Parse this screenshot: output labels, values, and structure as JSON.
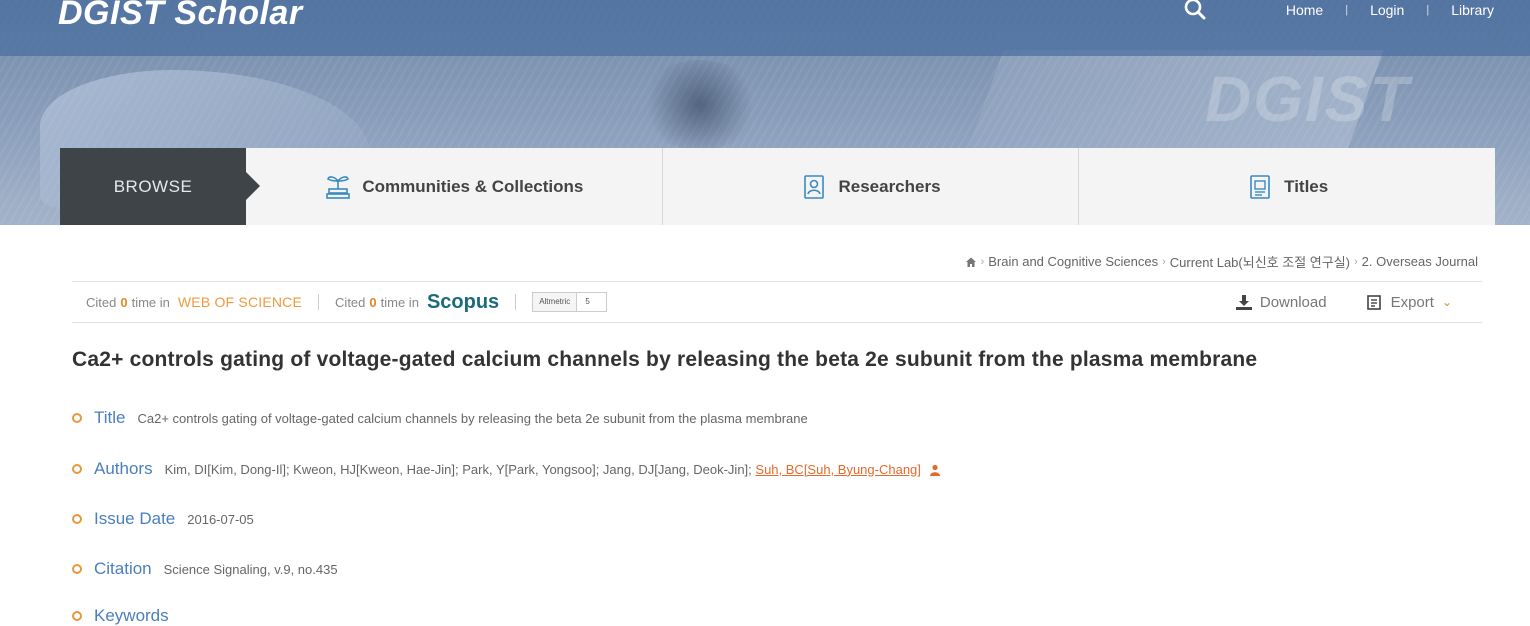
{
  "header": {
    "logo": "DGIST Scholar",
    "watermark": "DGIST",
    "nav": [
      {
        "label": "Home"
      },
      {
        "label": "Login"
      },
      {
        "label": "Library"
      }
    ]
  },
  "browse": {
    "label": "BROWSE",
    "tabs": [
      {
        "label": "Communities & Collections",
        "icon": "sprout-icon"
      },
      {
        "label": "Researchers",
        "icon": "id-badge-icon"
      },
      {
        "label": "Titles",
        "icon": "document-icon"
      }
    ]
  },
  "breadcrumb": {
    "home_icon": "home-icon",
    "items": [
      "Brain and Cognitive Sciences",
      "Current Lab(뇌신호 조절 연구실)",
      "2. Overseas Journal"
    ]
  },
  "metrics": {
    "cited_prefix": "Cited",
    "wos_count": "0",
    "cited_suffix": "time in",
    "wos_label": "WEB OF SCIENCE",
    "scopus_count": "0",
    "scopus_label": "Scopus",
    "altmetric_label": "Altmetric",
    "altmetric_value": "5",
    "download_label": "Download",
    "export_label": "Export"
  },
  "record": {
    "heading": "Ca2+ controls gating of voltage-gated calcium channels by releasing the beta 2e subunit from the plasma membrane",
    "fields": {
      "title_label": "Title",
      "title_value": "Ca2+ controls gating of voltage-gated calcium channels by releasing the beta 2e subunit from the plasma membrane",
      "authors_label": "Authors",
      "authors_value": "Kim, DI[Kim, Dong-Il]; Kweon, HJ[Kweon, Hae-Jin]; Park, Y[Park, Yongsoo]; Jang, DJ[Jang, Deok-Jin];",
      "authors_link": "Suh, BC[Suh, Byung-Chang]",
      "issue_date_label": "Issue Date",
      "issue_date_value": "2016-07-05",
      "citation_label": "Citation",
      "citation_value": "Science Signaling, v.9, no.435",
      "keywords_label": "Keywords"
    }
  },
  "colors": {
    "topbar": "#4a6ea0",
    "browse_dark": "#3e4448",
    "accent_orange": "#e49a3c",
    "label_blue": "#4a7fbd",
    "scopus_teal": "#1b6b7a"
  }
}
